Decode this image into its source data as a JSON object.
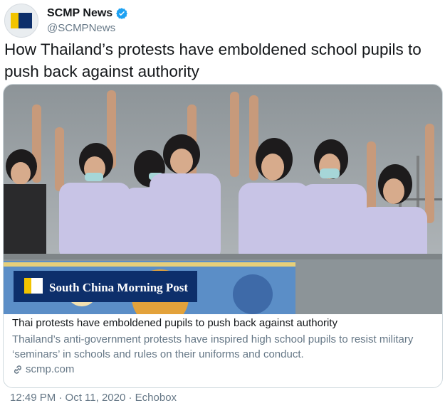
{
  "tweet": {
    "author": {
      "display_name": "SCMP News",
      "handle": "@SCMPNews",
      "verified_icon": "verified-badge-icon",
      "verified_color": "#1da1f2",
      "avatar_icon": "scmp-logo-icon"
    },
    "text": "How Thailand’s protests have emboldened school pupils to push back against authority",
    "timestamp": "12:49 PM · Oct 11, 2020",
    "separator": "·",
    "source": "Echobox"
  },
  "card": {
    "image_logo": "South China Morning Post",
    "title": "Thai protests have emboldened pupils to push back against authority",
    "description": "Thailand’s anti-government protests have inspired high school pupils to resist military ‘seminars’ in schools and rules on their uniforms and conduct.",
    "domain": "scmp.com",
    "domain_icon": "link-icon"
  },
  "colors": {
    "brand_yellow": "#f2c400",
    "brand_navy": "#0d2f6b",
    "text_primary": "#14171a",
    "text_secondary": "#657786"
  }
}
